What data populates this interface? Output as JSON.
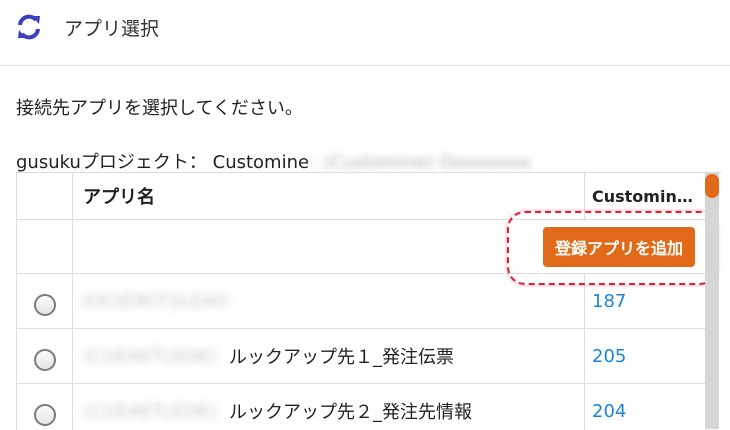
{
  "header": {
    "title": "アプリ選択"
  },
  "instruction": "接続先アプリを選択してください。",
  "project": {
    "label": "gusukuプロジェクト： Customine",
    "redacted": "- (Customine) Oooooooo"
  },
  "table": {
    "columns": {
      "name": "アプリ名",
      "customine": "Customin…"
    },
    "add_button": "登録アプリを追加",
    "rows": [
      {
        "redacted_prefix": "IOC(EIKIT)(LEAO)",
        "name": "",
        "id": "187"
      },
      {
        "redacted_prefix": "(C)(EAETLEOE)",
        "name": "ルックアップ先１_発注伝票",
        "id": "205"
      },
      {
        "redacted_prefix": "(C)(EAETLEOE)",
        "name": "ルックアップ先２_発注先情報",
        "id": "204"
      }
    ]
  },
  "colors": {
    "accent": "#e06a19",
    "link": "#1a84d8",
    "icon": "#3b3fc4",
    "highlight": "#e0202e"
  }
}
